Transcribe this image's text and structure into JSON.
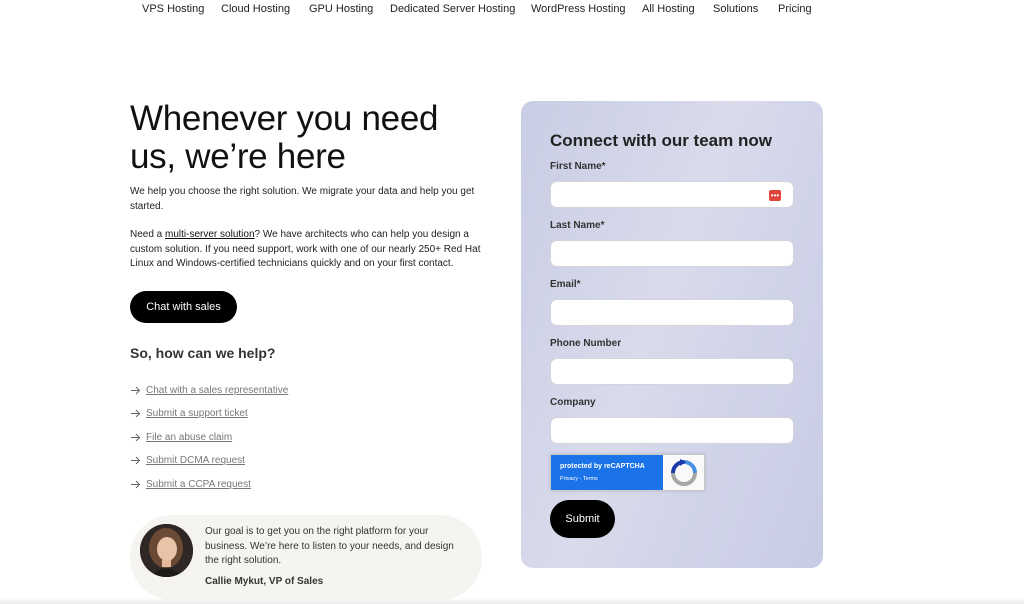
{
  "nav": {
    "items": [
      "VPS Hosting",
      "Cloud Hosting",
      "GPU Hosting",
      "Dedicated Server Hosting",
      "WordPress Hosting",
      "All Hosting",
      "Solutions",
      "Pricing"
    ]
  },
  "hero": {
    "headline_line1": "Whenever you need",
    "headline_line2": "us, we’re here",
    "intro": "We help you choose the right solution. We migrate your data and help you get started.",
    "para2_prefix": "Need a ",
    "para2_link": "multi-server solution",
    "para2_suffix": "? We have architects who can help you design a custom solution. If you need support, work with one of our nearly 250+ Red Hat Linux and Windows-certified technicians quickly and on your first contact.",
    "chat_button": "Chat with sales"
  },
  "help": {
    "heading": "So, how can we help?",
    "links": [
      "Chat with a sales representative",
      "Submit a support ticket",
      "File an abuse claim",
      "Submit DCMA request",
      "Submit a CCPA request"
    ]
  },
  "quote": {
    "text": "Our goal is to get you on the right platform for your business. We’re here to listen to your needs, and design the right solution.",
    "author": "Callie Mykut, VP of Sales"
  },
  "form": {
    "title": "Connect with our team now",
    "fields": [
      {
        "label": "First Name*",
        "value": ""
      },
      {
        "label": "Last Name*",
        "value": ""
      },
      {
        "label": "Email*",
        "value": ""
      },
      {
        "label": "Phone Number",
        "value": ""
      },
      {
        "label": "Company",
        "value": ""
      }
    ],
    "recaptcha_main": "protected by reCAPTCHA",
    "recaptcha_sub": "Privacy - Terms",
    "submit": "Submit"
  },
  "icons": {
    "link_arrow": "arrow-right-icon",
    "password_manager": "password-manager-icon",
    "recaptcha_logo": "recaptcha-logo-icon"
  },
  "colors": {
    "button_bg": "#000000",
    "form_card_bg": "#d3d6ea",
    "recaptcha_blue": "#1a73e8",
    "password_icon": "#e0443a"
  }
}
